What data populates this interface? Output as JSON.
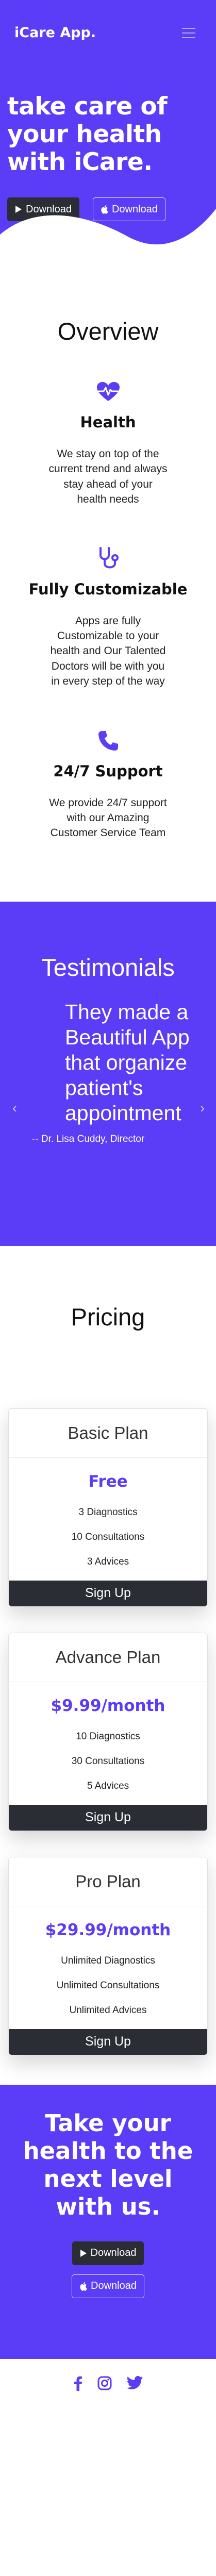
{
  "nav": {
    "brand": "iCare App.",
    "menu_icon": "hamburger-menu-icon"
  },
  "hero": {
    "title_lines": [
      "take care of",
      "your health",
      "with iCare."
    ],
    "download_label": "Download",
    "download_apple_label": "Download",
    "play_icon": "play-icon",
    "apple_icon": "apple-icon"
  },
  "overview": {
    "title": "Overview",
    "features": [
      {
        "icon": "heartbeat-icon",
        "title": "Health",
        "text": "We stay on top of the current trend and always stay ahead of your health needs"
      },
      {
        "icon": "stethoscope-icon",
        "title": "Fully Customizable",
        "text": "Apps are fully Customizable to your health and Our Talented Doctors will be with you in every step of the way"
      },
      {
        "icon": "phone-icon",
        "title": "24/7 Support",
        "text": "We provide 24/7 support with our Amazing Customer Service Team"
      }
    ]
  },
  "testimonials": {
    "title": "Testimonials",
    "quote": "They made a Beautiful App that organize patient's appointment",
    "author": "-- Dr. Lisa Cuddy, Director",
    "prev_symbol": "‹",
    "next_symbol": "›"
  },
  "pricing": {
    "title": "Pricing",
    "plans": [
      {
        "name": "Basic Plan",
        "price": "Free",
        "features": [
          "3 Diagnostics",
          "10 Consultations",
          "3 Advices"
        ],
        "button": "Sign Up"
      },
      {
        "name": "Advance Plan",
        "price": "$9.99/month",
        "features": [
          "10 Diagnostics",
          "30 Consultations",
          "5 Advices"
        ],
        "button": "Sign Up"
      },
      {
        "name": "Pro Plan",
        "price": "$29.99/month",
        "features": [
          "Unlimited Diagnostics",
          "Unlimited Consultations",
          "Unlimited Advices"
        ],
        "button": "Sign Up"
      }
    ]
  },
  "cta": {
    "title": "Take your health to the next level with us.",
    "download_label": "Download",
    "download_apple_label": "Download"
  },
  "footer": {
    "icons": [
      "facebook-icon",
      "instagram-icon",
      "twitter-icon"
    ]
  },
  "colors": {
    "brand": "#5b3cf7",
    "dark": "#2b2d35",
    "white": "#ffffff"
  }
}
